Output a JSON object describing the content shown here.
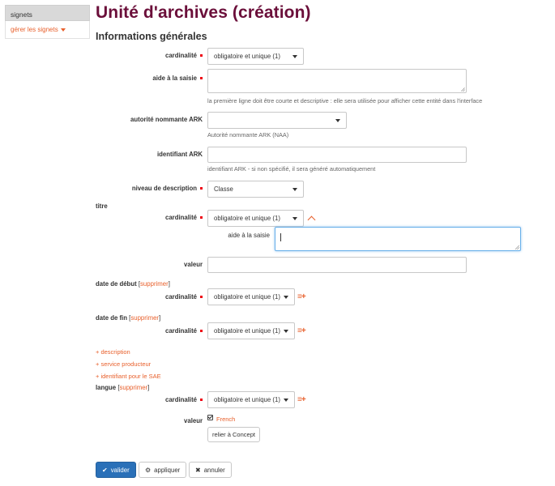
{
  "sidebar": {
    "header": "signets",
    "link": "gérer les signets"
  },
  "page": {
    "title": "Unité d'archives (création)",
    "section_title": "Informations générales"
  },
  "fields": {
    "cardinality_label": "cardinalité",
    "cardinality_value": "obligatoire et unique (1)",
    "help_label": "aide à la saisie",
    "help_hint": "la première ligne doit être courte et descriptive : elle sera utilisée pour afficher cette entité dans l'interface",
    "ark_authority_label": "autorité nommante ARK",
    "ark_authority_hint": "Autorité nommante ARK (NAA)",
    "ark_id_label": "identifiant ARK",
    "ark_id_hint": "identifiant ARK - si non spécifié, il sera généré automatiquement",
    "level_label": "niveau de description",
    "level_value": "Classe"
  },
  "titre": {
    "heading": "titre",
    "cardinality_label": "cardinalité",
    "cardinality_value": "obligatoire et unique (1)",
    "help_label": "aide à la saisie",
    "value_label": "valeur"
  },
  "start_date": {
    "heading": "date de début",
    "bracket_open": "[",
    "delete": "supprimer",
    "bracket_close": "]",
    "cardinality_label": "cardinalité",
    "cardinality_value": "obligatoire et unique (1)"
  },
  "end_date": {
    "heading": "date de fin",
    "bracket_open": "[",
    "delete": "supprimer",
    "bracket_close": "]",
    "cardinality_label": "cardinalité",
    "cardinality_value": "obligatoire et unique (1)"
  },
  "optional_links": [
    "+ description",
    "+ service producteur",
    "+ identifiant pour le SAE"
  ],
  "langue": {
    "heading": "langue",
    "bracket_open": "[",
    "delete": "supprimer",
    "bracket_close": "]",
    "cardinality_label": "cardinalité",
    "cardinality_value": "obligatoire et unique (1)",
    "value_label": "valeur",
    "value": "French",
    "concept_button": "relier à Concept"
  },
  "actions": {
    "validate": "valider",
    "apply": "appliquer",
    "cancel": "annuler"
  },
  "icons": {
    "add_list": "≡+",
    "validate": "✔",
    "apply": "⚙",
    "cancel": "✖"
  },
  "colors": {
    "title": "#6b0f3a",
    "accent": "#e8602c",
    "primary_button": "#2a70b8",
    "required": "#ee0011"
  }
}
